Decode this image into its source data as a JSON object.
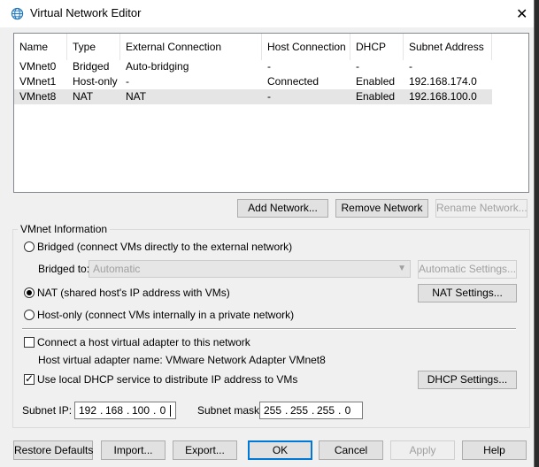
{
  "window": {
    "title": "Virtual Network Editor",
    "close_glyph": "✕",
    "icon": "globe-network-icon"
  },
  "table": {
    "columns": [
      "Name",
      "Type",
      "External Connection",
      "Host Connection",
      "DHCP",
      "Subnet Address"
    ],
    "rows": [
      [
        "VMnet0",
        "Bridged",
        "Auto-bridging",
        "-",
        "-",
        "-"
      ],
      [
        "VMnet1",
        "Host-only",
        "-",
        "Connected",
        "Enabled",
        "192.168.174.0"
      ],
      [
        "VMnet8",
        "NAT",
        "NAT",
        "-",
        "Enabled",
        "192.168.100.0"
      ]
    ],
    "selected_row": 2
  },
  "table_buttons": {
    "add": "Add Network...",
    "remove": "Remove Network",
    "rename": "Rename Network..."
  },
  "vmnet_info": {
    "group_label": "VMnet Information",
    "bridged_label": "Bridged (connect VMs directly to the external network)",
    "bridged_to_label": "Bridged to:",
    "bridged_to_value": "Automatic",
    "automatic_settings": "Automatic Settings...",
    "nat_label": "NAT (shared host's IP address with VMs)",
    "nat_settings": "NAT Settings...",
    "hostonly_label": "Host-only (connect VMs internally in a private network)",
    "connect_adapter_label": "Connect a host virtual adapter to this network",
    "adapter_name_text": "Host virtual adapter name: VMware Network Adapter VMnet8",
    "dhcp_label": "Use local DHCP service to distribute IP address to VMs",
    "dhcp_settings": "DHCP Settings...",
    "subnet_ip_label": "Subnet IP:",
    "subnet_ip": [
      "192",
      "168",
      "100",
      "0"
    ],
    "subnet_mask_label": "Subnet mask:",
    "subnet_mask": [
      "255",
      "255",
      "255",
      "0"
    ],
    "mode": "NAT",
    "connect_adapter_checked": false,
    "dhcp_checked": true
  },
  "footer": {
    "restore": "Restore Defaults",
    "import": "Import...",
    "export": "Export...",
    "ok": "OK",
    "cancel": "Cancel",
    "apply": "Apply",
    "help": "Help"
  }
}
